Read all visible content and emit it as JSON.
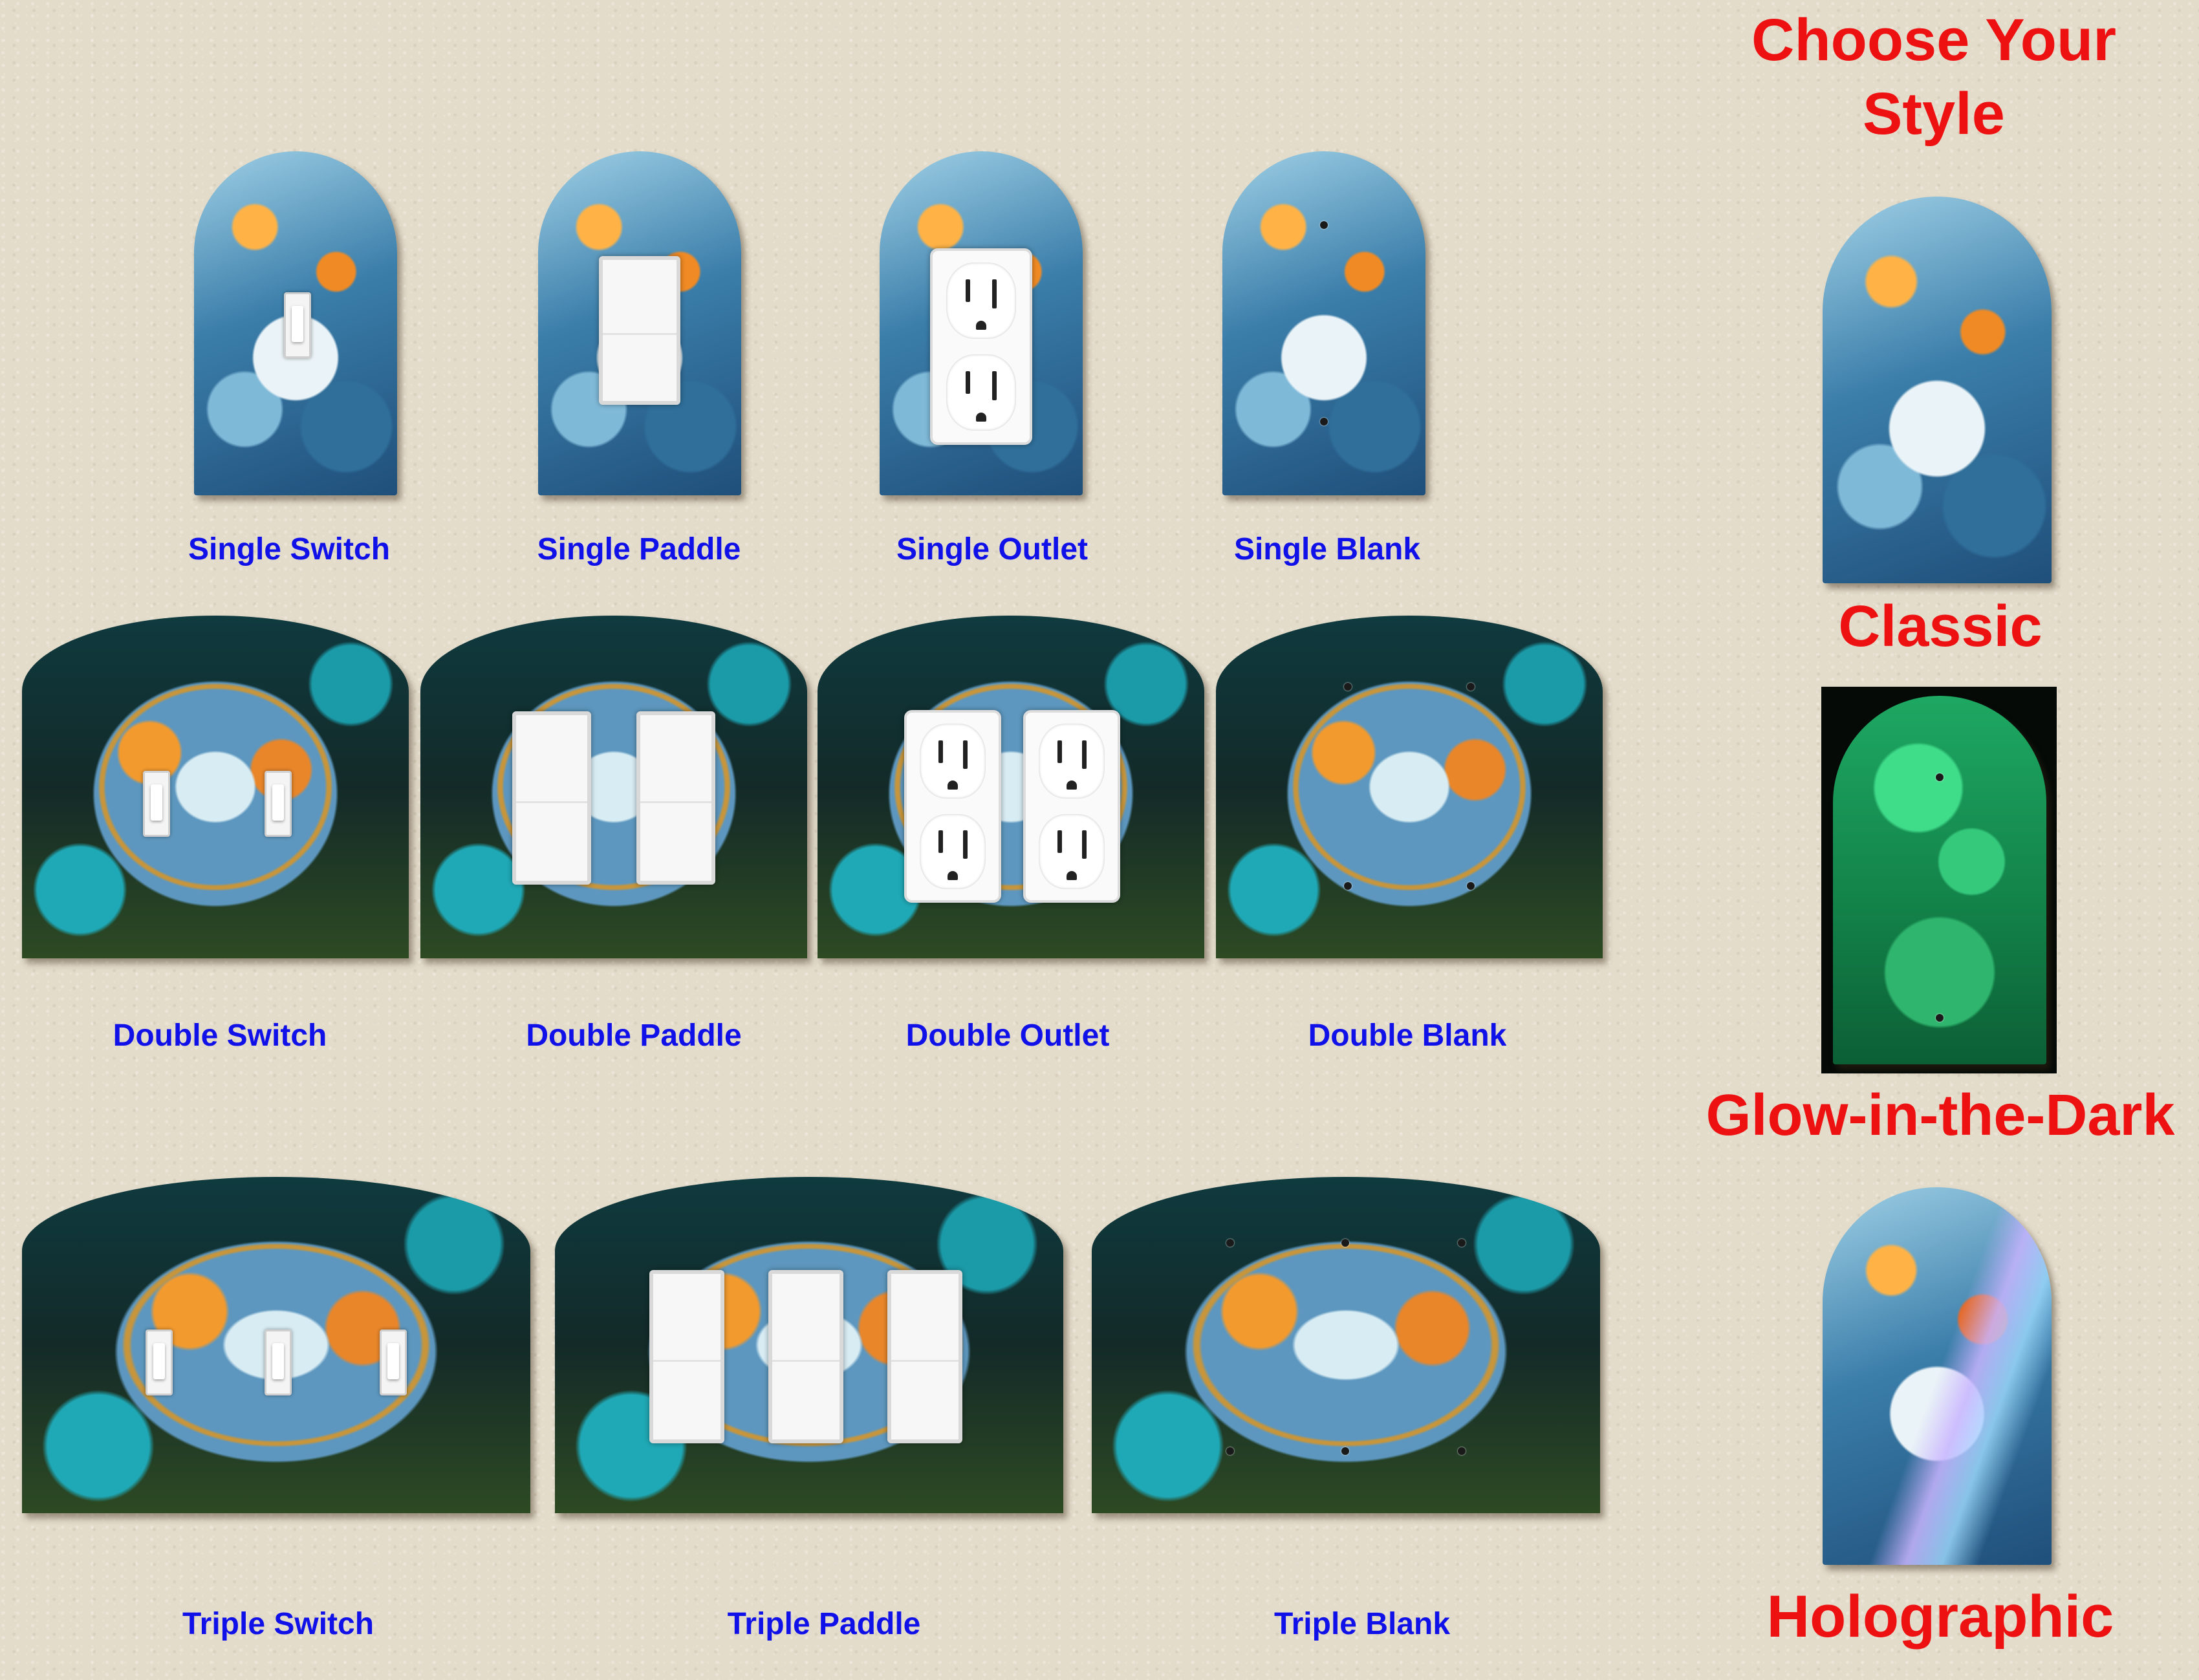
{
  "heading": {
    "line1": "Choose Your",
    "line2": "Style"
  },
  "styles": {
    "classic": "Classic",
    "glow": "Glow-in-the-Dark",
    "holographic": "Holographic"
  },
  "singles": [
    "Single Switch",
    "Single Paddle",
    "Single Outlet",
    "Single Blank"
  ],
  "doubles": [
    "Double Switch",
    "Double Paddle",
    "Double Outlet",
    "Double Blank"
  ],
  "triples": [
    "Triple Switch",
    "Triple Paddle",
    "Triple Blank"
  ]
}
